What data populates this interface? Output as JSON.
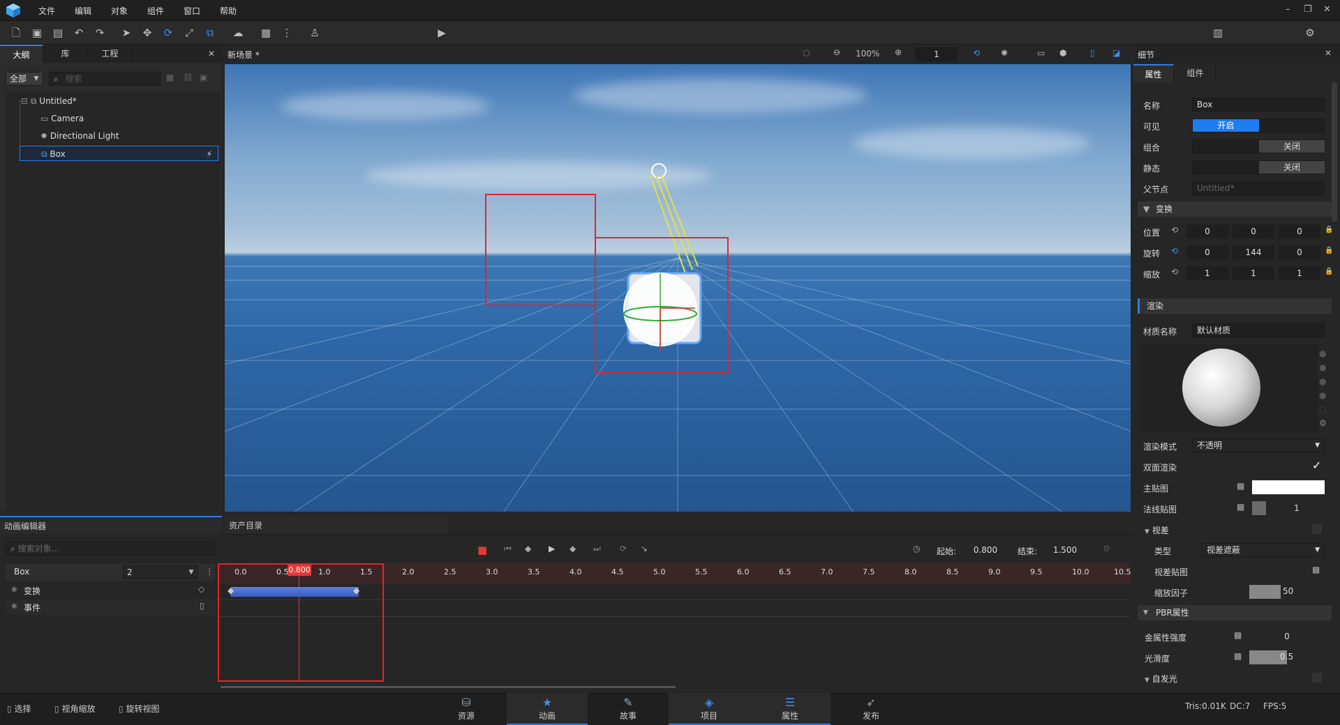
{
  "menu": {
    "items": [
      "文件",
      "编辑",
      "对象",
      "组件",
      "窗口",
      "帮助"
    ]
  },
  "toolbar": {
    "preview_label": "预览",
    "layout_label": "经典"
  },
  "left_panel": {
    "tabs": [
      "大纲",
      "库",
      "工程"
    ],
    "filter": "全部",
    "search_placeholder": "搜索",
    "tree": [
      "Untitled*",
      "Camera",
      "Directional Light",
      "Box"
    ]
  },
  "scene": {
    "tab_title": "新场景 *",
    "zoom": "100%",
    "frame_value": "1"
  },
  "details": {
    "title": "细节",
    "tabs": [
      "属性",
      "组件"
    ],
    "name_label": "名称",
    "name_value": "Box",
    "visible_label": "可见",
    "visible_value": "开启",
    "group_label": "组合",
    "group_value": "关闭",
    "static_label": "静态",
    "static_value": "关闭",
    "parent_label": "父节点",
    "parent_value": "Untitled*",
    "transform_section": "变换",
    "position_label": "位置",
    "position": [
      "0",
      "0",
      "0"
    ],
    "rotation_label": "旋转",
    "rotation": [
      "0",
      "144",
      "0"
    ],
    "scale_label": "缩放",
    "scale": [
      "1",
      "1",
      "1"
    ],
    "render_section": "渲染",
    "material_label": "材质名称",
    "material_value": "默认材质",
    "render_mode_label": "渲染模式",
    "render_mode_value": "不透明",
    "double_side_label": "双面渲染",
    "main_tex_label": "主贴图",
    "normal_tex_label": "法线贴图",
    "normal_value": "1",
    "parallax_section": "视差",
    "type_label": "类型",
    "type_value": "视差遮蔽",
    "parallax_tex_label": "视差贴图",
    "scale_factor_label": "缩放因子",
    "scale_factor_value": "50",
    "pbr_section": "PBR属性",
    "metal_label": "金属性强度",
    "metal_value": "0",
    "smooth_label": "光滑度",
    "smooth_value": "0.5",
    "emission_section": "自发光"
  },
  "anim_editor": {
    "title": "动画编辑器",
    "search_placeholder": "搜索对象...",
    "object": "Box",
    "object_count": "2",
    "tracks": [
      "变换",
      "事件"
    ]
  },
  "assets": {
    "title": "资产目录"
  },
  "timeline": {
    "start_label": "起始:",
    "start_value": "0.800",
    "end_label": "结束:",
    "end_value": "1.500",
    "playhead": "0.800",
    "ticks": [
      "0.0",
      "0.5",
      "1.0",
      "1.5",
      "2.0",
      "2.5",
      "3.0",
      "3.5",
      "4.0",
      "4.5",
      "5.0",
      "5.5",
      "6.0",
      "6.5",
      "7.0",
      "7.5",
      "8.0",
      "8.5",
      "9.0",
      "9.5",
      "10.0",
      "10.5"
    ]
  },
  "bottom_left": {
    "items": [
      "选择",
      "视角缩放",
      "旋转视图"
    ]
  },
  "bottom_nav": {
    "items": [
      "资源",
      "动画",
      "故事",
      "项目",
      "属性",
      "发布"
    ]
  },
  "status": {
    "tris": "Tris:0.01K",
    "dc": "DC:7",
    "fps": "FPS:5"
  }
}
